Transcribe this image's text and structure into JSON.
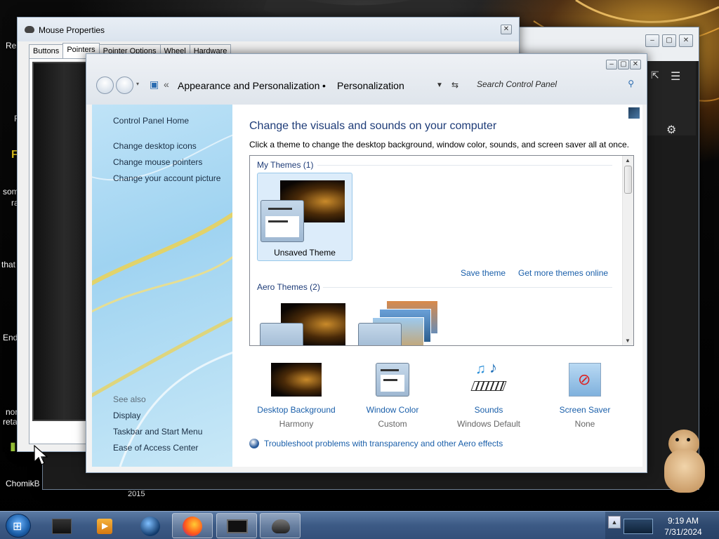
{
  "desktop": {
    "labels": [
      "Re",
      "F",
      "som",
      "ra",
      "that",
      "End",
      "nor",
      "reta",
      "ChomikB",
      "2015"
    ]
  },
  "mouse_properties": {
    "title": "Mouse Properties",
    "tabs": [
      "Buttons",
      "Pointers",
      "Pointer Options",
      "Wheel",
      "Hardware"
    ],
    "active_tab": "Pointers"
  },
  "control_panel": {
    "breadcrumb": {
      "nav_prefix": "«",
      "items": [
        "Appearance and Personalization",
        "Personalization"
      ],
      "separator": "•"
    },
    "search": {
      "placeholder": "Search Control Panel"
    },
    "sidebar": {
      "links": [
        "Control Panel Home",
        "Change desktop icons",
        "Change mouse pointers",
        "Change your account picture"
      ],
      "see_also_heading": "See also",
      "see_also": [
        "Display",
        "Taskbar and Start Menu",
        "Ease of Access Center"
      ]
    },
    "main": {
      "title": "Change the visuals and sounds on your computer",
      "subtitle": "Click a theme to change the desktop background, window color, sounds, and screen saver all at once.",
      "groups": [
        {
          "heading": "My Themes (1)",
          "themes": [
            "Unsaved Theme"
          ]
        },
        {
          "heading": "Aero Themes (2)"
        }
      ],
      "save_theme": "Save theme",
      "get_more": "Get more themes online"
    },
    "bottom": [
      {
        "label": "Desktop Background",
        "value": "Harmony",
        "icon": "desktop-background-icon"
      },
      {
        "label": "Window Color",
        "value": "Custom",
        "icon": "window-color-icon"
      },
      {
        "label": "Sounds",
        "value": "Windows Default",
        "icon": "sounds-icon"
      },
      {
        "label": "Screen Saver",
        "value": "None",
        "icon": "screen-saver-icon"
      }
    ],
    "troubleshoot": "Troubleshoot problems with transparency and other Aero effects"
  },
  "taskbar": {
    "time": "9:19 AM",
    "date": "7/31/2024",
    "apps": [
      "file-manager-icon",
      "media-player-icon",
      "network-globe-icon",
      "firefox-icon",
      "monitor-app-icon",
      "mouse-app-icon"
    ]
  },
  "colors": {
    "link": "#1a5faa",
    "heading": "#1e3c78",
    "taskbar": "#3c5a85"
  }
}
